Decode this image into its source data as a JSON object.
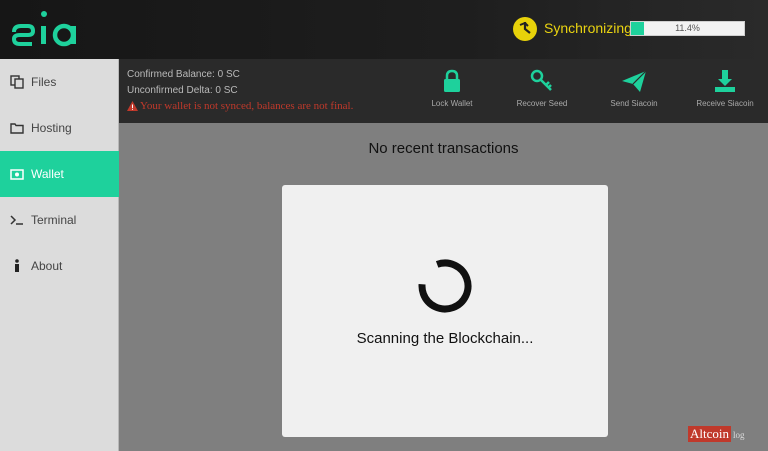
{
  "app": {
    "logo_text": "sia"
  },
  "header": {
    "sync_label": "Synchronizing",
    "progress_percent": 11.4,
    "progress_text": "11.4%"
  },
  "sidebar": {
    "items": [
      {
        "label": "Files",
        "icon": "files-icon",
        "active": false
      },
      {
        "label": "Hosting",
        "icon": "folder-icon",
        "active": false
      },
      {
        "label": "Wallet",
        "icon": "wallet-icon",
        "active": true
      },
      {
        "label": "Terminal",
        "icon": "terminal-icon",
        "active": false
      },
      {
        "label": "About",
        "icon": "info-icon",
        "active": false
      }
    ]
  },
  "wallet": {
    "confirmed_balance": "Confirmed Balance: 0 SC",
    "unconfirmed_delta": "Unconfirmed Delta: 0 SC",
    "warning": "Your wallet is not synced, balances are not final.",
    "actions": [
      {
        "label": "Lock Wallet",
        "icon": "lock-icon"
      },
      {
        "label": "Recover Seed",
        "icon": "key-icon"
      },
      {
        "label": "Send Siacoin",
        "icon": "paper-plane-icon"
      },
      {
        "label": "Receive Siacoin",
        "icon": "download-icon"
      }
    ]
  },
  "main": {
    "no_transactions": "No recent transactions",
    "scanning_text": "Scanning the Blockchain..."
  },
  "watermark": {
    "main": "Altcoin",
    "sub": "log"
  },
  "colors": {
    "accent": "#1ed19c",
    "sync_yellow": "#e8d20a",
    "warning_red": "#c0392b"
  }
}
